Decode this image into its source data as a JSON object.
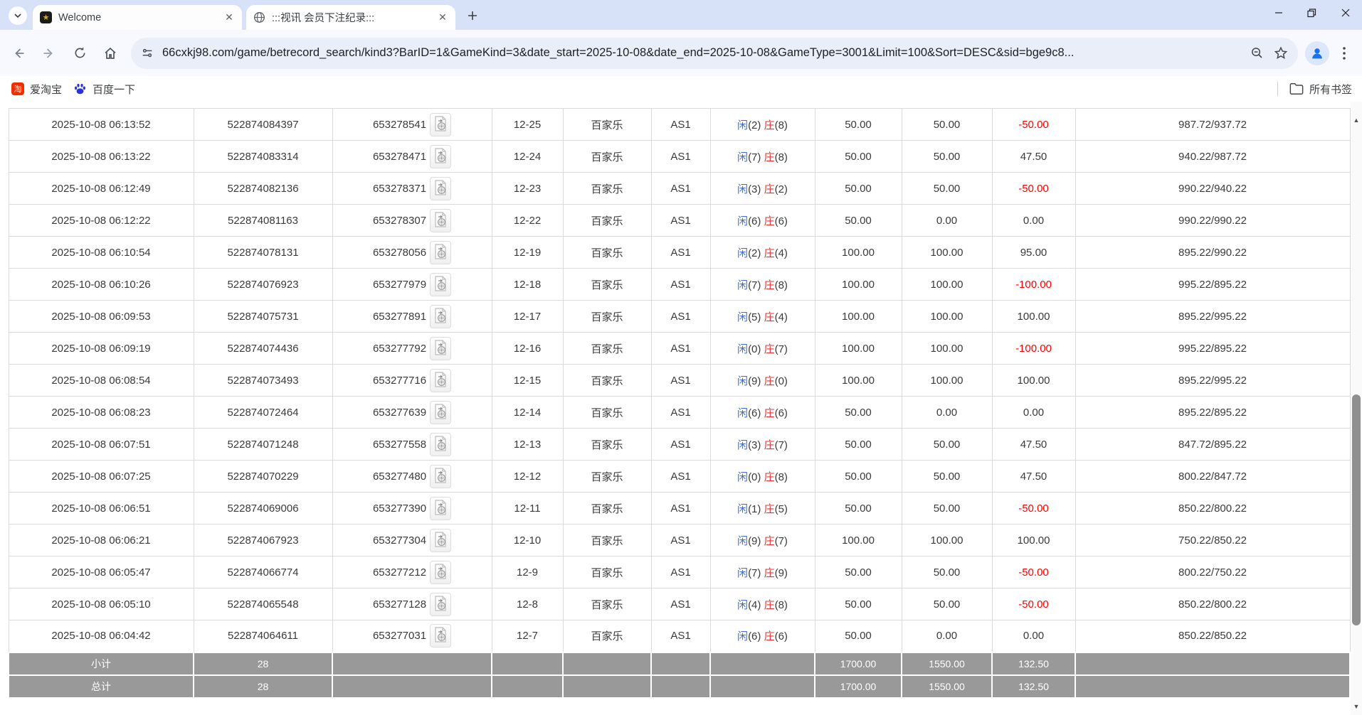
{
  "browser": {
    "tabs": [
      {
        "title": "Welcome"
      },
      {
        "title": ":::视讯 会员下注纪录:::"
      }
    ],
    "url": "66cxkj98.com/game/betrecord_search/kind3?BarID=1&GameKind=3&date_start=2025-10-08&date_end=2025-10-08&GameType=3001&Limit=100&Sort=DESC&sid=bge9c8...",
    "bookmarks": {
      "items": [
        "爱淘宝",
        "百度一下"
      ],
      "all_label": "所有书签"
    }
  },
  "colors": {
    "tabstrip_bg": "#d7e2f9",
    "link_blue": "#3366cc",
    "loss_red": "#ff0000",
    "player_blue": "#3b6fd6",
    "banker_red": "#e53333",
    "footer_gray": "#999999"
  },
  "table": {
    "bet_labels": {
      "player": "闲",
      "banker": "庄"
    },
    "rows": [
      {
        "time": "2025-10-08 06:13:52",
        "order": "522874084397",
        "game": "653278541",
        "round": "12-25",
        "type": "百家乐",
        "table": "AS1",
        "p": "2",
        "b": "8",
        "bet": "50.00",
        "valid": "50.00",
        "result": "-50.00",
        "balance": "987.72/937.72"
      },
      {
        "time": "2025-10-08 06:13:22",
        "order": "522874083314",
        "game": "653278471",
        "round": "12-24",
        "type": "百家乐",
        "table": "AS1",
        "p": "7",
        "b": "8",
        "bet": "50.00",
        "valid": "50.00",
        "result": "47.50",
        "balance": "940.22/987.72"
      },
      {
        "time": "2025-10-08 06:12:49",
        "order": "522874082136",
        "game": "653278371",
        "round": "12-23",
        "type": "百家乐",
        "table": "AS1",
        "p": "3",
        "b": "2",
        "bet": "50.00",
        "valid": "50.00",
        "result": "-50.00",
        "balance": "990.22/940.22"
      },
      {
        "time": "2025-10-08 06:12:22",
        "order": "522874081163",
        "game": "653278307",
        "round": "12-22",
        "type": "百家乐",
        "table": "AS1",
        "p": "6",
        "b": "6",
        "bet": "50.00",
        "valid": "0.00",
        "result": "0.00",
        "balance": "990.22/990.22"
      },
      {
        "time": "2025-10-08 06:10:54",
        "order": "522874078131",
        "game": "653278056",
        "round": "12-19",
        "type": "百家乐",
        "table": "AS1",
        "p": "2",
        "b": "4",
        "bet": "100.00",
        "valid": "100.00",
        "result": "95.00",
        "balance": "895.22/990.22"
      },
      {
        "time": "2025-10-08 06:10:26",
        "order": "522874076923",
        "game": "653277979",
        "round": "12-18",
        "type": "百家乐",
        "table": "AS1",
        "p": "7",
        "b": "8",
        "bet": "100.00",
        "valid": "100.00",
        "result": "-100.00",
        "balance": "995.22/895.22"
      },
      {
        "time": "2025-10-08 06:09:53",
        "order": "522874075731",
        "game": "653277891",
        "round": "12-17",
        "type": "百家乐",
        "table": "AS1",
        "p": "5",
        "b": "4",
        "bet": "100.00",
        "valid": "100.00",
        "result": "100.00",
        "balance": "895.22/995.22"
      },
      {
        "time": "2025-10-08 06:09:19",
        "order": "522874074436",
        "game": "653277792",
        "round": "12-16",
        "type": "百家乐",
        "table": "AS1",
        "p": "0",
        "b": "7",
        "bet": "100.00",
        "valid": "100.00",
        "result": "-100.00",
        "balance": "995.22/895.22"
      },
      {
        "time": "2025-10-08 06:08:54",
        "order": "522874073493",
        "game": "653277716",
        "round": "12-15",
        "type": "百家乐",
        "table": "AS1",
        "p": "9",
        "b": "0",
        "bet": "100.00",
        "valid": "100.00",
        "result": "100.00",
        "balance": "895.22/995.22"
      },
      {
        "time": "2025-10-08 06:08:23",
        "order": "522874072464",
        "game": "653277639",
        "round": "12-14",
        "type": "百家乐",
        "table": "AS1",
        "p": "6",
        "b": "6",
        "bet": "50.00",
        "valid": "0.00",
        "result": "0.00",
        "balance": "895.22/895.22"
      },
      {
        "time": "2025-10-08 06:07:51",
        "order": "522874071248",
        "game": "653277558",
        "round": "12-13",
        "type": "百家乐",
        "table": "AS1",
        "p": "3",
        "b": "7",
        "bet": "50.00",
        "valid": "50.00",
        "result": "47.50",
        "balance": "847.72/895.22"
      },
      {
        "time": "2025-10-08 06:07:25",
        "order": "522874070229",
        "game": "653277480",
        "round": "12-12",
        "type": "百家乐",
        "table": "AS1",
        "p": "0",
        "b": "8",
        "bet": "50.00",
        "valid": "50.00",
        "result": "47.50",
        "balance": "800.22/847.72"
      },
      {
        "time": "2025-10-08 06:06:51",
        "order": "522874069006",
        "game": "653277390",
        "round": "12-11",
        "type": "百家乐",
        "table": "AS1",
        "p": "1",
        "b": "5",
        "bet": "50.00",
        "valid": "50.00",
        "result": "-50.00",
        "balance": "850.22/800.22"
      },
      {
        "time": "2025-10-08 06:06:21",
        "order": "522874067923",
        "game": "653277304",
        "round": "12-10",
        "type": "百家乐",
        "table": "AS1",
        "p": "9",
        "b": "7",
        "bet": "100.00",
        "valid": "100.00",
        "result": "100.00",
        "balance": "750.22/850.22"
      },
      {
        "time": "2025-10-08 06:05:47",
        "order": "522874066774",
        "game": "653277212",
        "round": "12-9",
        "type": "百家乐",
        "table": "AS1",
        "p": "7",
        "b": "9",
        "bet": "50.00",
        "valid": "50.00",
        "result": "-50.00",
        "balance": "800.22/750.22"
      },
      {
        "time": "2025-10-08 06:05:10",
        "order": "522874065548",
        "game": "653277128",
        "round": "12-8",
        "type": "百家乐",
        "table": "AS1",
        "p": "4",
        "b": "8",
        "bet": "50.00",
        "valid": "50.00",
        "result": "-50.00",
        "balance": "850.22/800.22"
      },
      {
        "time": "2025-10-08 06:04:42",
        "order": "522874064611",
        "game": "653277031",
        "round": "12-7",
        "type": "百家乐",
        "table": "AS1",
        "p": "6",
        "b": "6",
        "bet": "50.00",
        "valid": "0.00",
        "result": "0.00",
        "balance": "850.22/850.22"
      }
    ],
    "footer": [
      {
        "label": "小计",
        "count": "28",
        "bet": "1700.00",
        "valid": "1550.00",
        "result": "132.50"
      },
      {
        "label": "总计",
        "count": "28",
        "bet": "1700.00",
        "valid": "1550.00",
        "result": "132.50"
      }
    ]
  }
}
